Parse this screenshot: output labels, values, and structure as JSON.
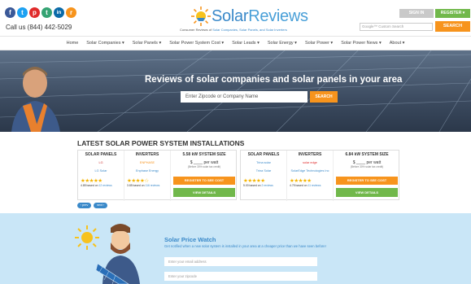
{
  "social": [
    {
      "name": "facebook-icon",
      "glyph": "f",
      "color": "#3b5998"
    },
    {
      "name": "twitter-icon",
      "glyph": "t",
      "color": "#1da1f2"
    },
    {
      "name": "pinterest-icon",
      "glyph": "p",
      "color": "#e02b2b"
    },
    {
      "name": "tumblr-icon",
      "glyph": "t",
      "color": "#35a373"
    },
    {
      "name": "linkedin-icon",
      "glyph": "in",
      "color": "#0a6aa8"
    },
    {
      "name": "rss-icon",
      "glyph": "r",
      "color": "#f7941d"
    }
  ],
  "header": {
    "phone": "Call us (844) 442-5029",
    "logo_text_1": "Solar",
    "logo_text_2": "Reviews",
    "tagline_prefix": "Consumer Reviews of",
    "tagline_link": "Solar Companies, Solar Panels, and Solar Inverters",
    "signin": "SIGN IN",
    "register": "REGISTER ▾",
    "search_placeholder": "Google™ Custom Search",
    "search_button": "SEARCH"
  },
  "nav": [
    "Home",
    "Solar Companies ▾",
    "Solar Panels ▾",
    "Solar Power System Cost ▾",
    "Solar Leads ▾",
    "Solar Energy ▾",
    "Solar Power ▾",
    "Solar Power News ▾",
    "About ▾"
  ],
  "hero": {
    "title": "Reviews of solar companies and solar panels in your area",
    "input_placeholder": "Enter Zipcode or Company Name",
    "button": "SEARCH"
  },
  "installations": {
    "title": "LATEST SOLAR POWER SYSTEM INSTALLATIONS",
    "cards": [
      {
        "panels_header": "SOLAR PANELS",
        "inverters_header": "INVERTERS",
        "size_header": "5.58 kW SYSTEM SIZE",
        "panel_brand": "LG",
        "inverter_brand": "ENPHASE",
        "panel_company": "LG Solar",
        "inverter_company": "Enphase Energy",
        "panel_stars": "★★★★★",
        "inverter_stars": "★★★★☆",
        "panel_rating": "4.85 based on",
        "panel_reviews": "12 reviews",
        "inverter_rating": "3.85 based on",
        "inverter_reviews": "116 reviews",
        "price": "$ ____ per watt",
        "price_sub": "(Before 30% solar tax credit)",
        "cost_button": "REGISTER TO SEE COST",
        "details_button": "VIEW DETAILS"
      },
      {
        "panels_header": "SOLAR PANELS",
        "inverters_header": "INVERTERS",
        "size_header": "6.84 kW SYSTEM SIZE",
        "panel_brand": "Trina solar",
        "inverter_brand": "solar edge",
        "panel_company": "Trina Solar",
        "inverter_company": "SolarEdge Technologies Inc",
        "panel_stars": "★★★★★",
        "inverter_stars": "★★★★★",
        "panel_rating": "5.00 based on",
        "panel_reviews": "2 reviews",
        "inverter_rating": "4.75 based on",
        "inverter_reviews": "11 reviews",
        "price": "$ ____ per watt",
        "price_sub": "(Before 30% solar tax credit)",
        "cost_button": "REGISTER TO SEE COST",
        "details_button": "VIEW DETAILS"
      }
    ],
    "prev": "‹ prev",
    "next": "next ›"
  },
  "watch": {
    "title": "Solar Price Watch",
    "description": "Get notified when a new solar system is installed in your area at a cheaper price than we have seen before!",
    "email_placeholder": "Enter your email address",
    "zip_placeholder": "Enter your zipcode"
  }
}
